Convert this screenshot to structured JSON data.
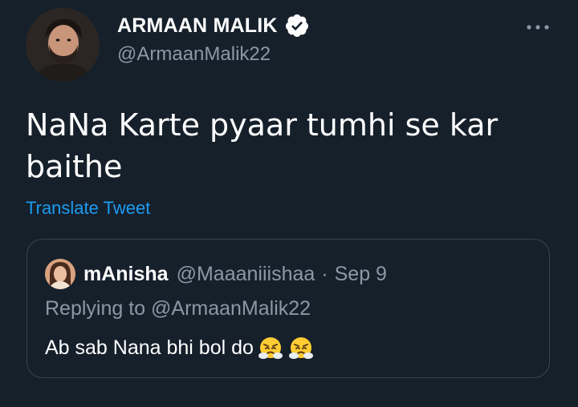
{
  "author": {
    "display_name": "ARMAAN MALIK",
    "handle": "@ArmaanMalik22",
    "verified": true,
    "avatar_icon": "avatar",
    "verified_icon": "verified-badge-icon"
  },
  "menu": {
    "more_icon": "more-options-icon"
  },
  "tweet": {
    "text": "NaNa Karte pyaar tumhi se kar baithe",
    "translate_label": "Translate Tweet"
  },
  "quoted_tweet": {
    "display_name": "mAnisha",
    "handle": "@Maaaniiishaa",
    "separator": "·",
    "date": "Sep 9",
    "replying_to": "Replying to @ArmaanMalik22",
    "text": "Ab sab Nana bhi bol do",
    "emoji": [
      "face-with-steam-from-nose",
      "face-with-steam-from-nose"
    ]
  },
  "colors": {
    "background": "#15202b",
    "link": "#1d9bf0",
    "secondary_text": "#8b98a5",
    "border": "#38444d"
  }
}
